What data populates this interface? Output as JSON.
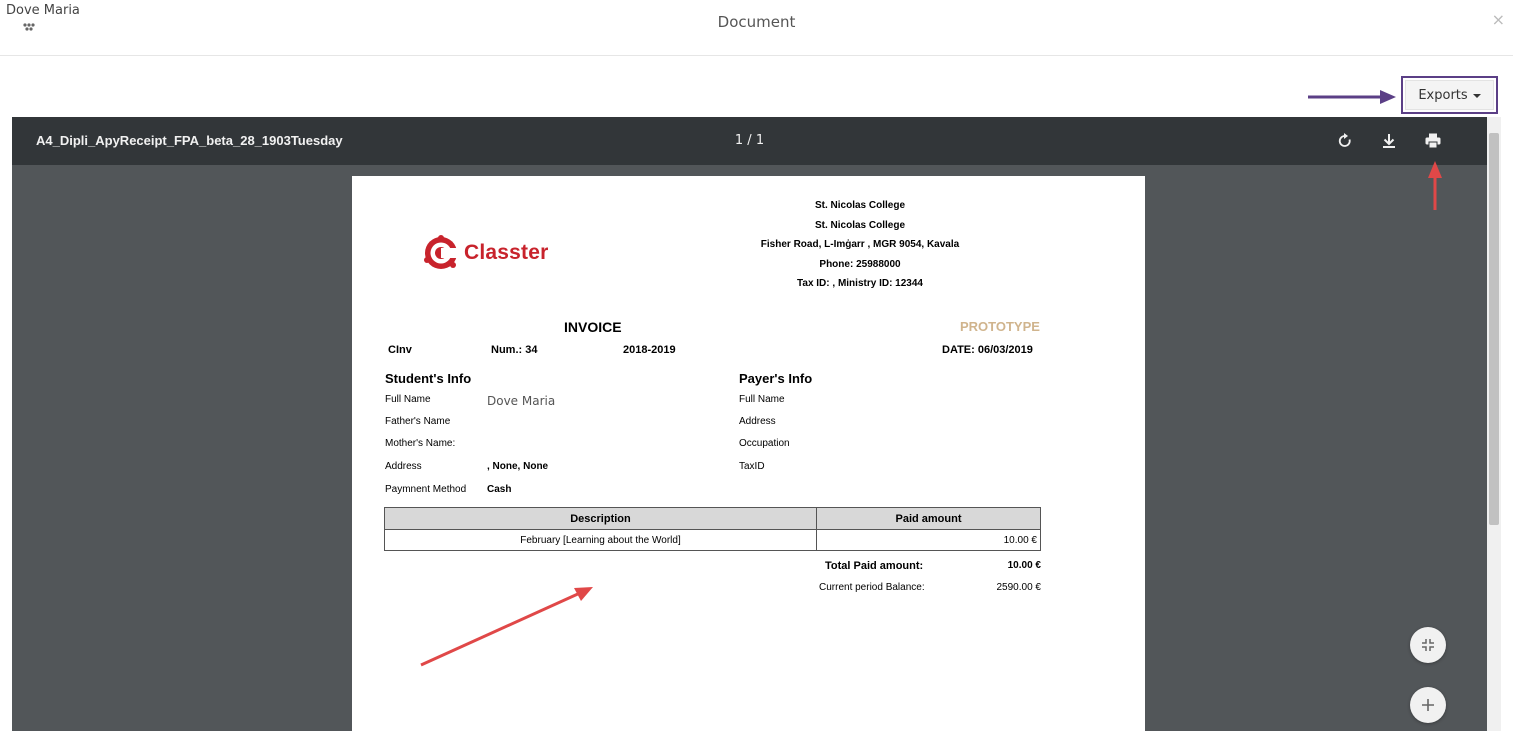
{
  "header": {
    "user_name": "Dove Maria",
    "title": "Document",
    "close_label": "×",
    "menu_icon": "grip-dots-icon"
  },
  "exports": {
    "label": "Exports"
  },
  "viewer": {
    "file_name": "A4_Dipli_ApyReceipt_FPA_beta_28_1903Tuesday",
    "page_counter": "1 / 1",
    "icons": [
      "rotate-icon",
      "download-icon",
      "print-icon"
    ],
    "zoom_icons": [
      "fit-page-icon",
      "zoom-in-icon"
    ]
  },
  "invoice": {
    "logo_text": "Classter",
    "school_lines": [
      "St. Nicolas College",
      "St. Nicolas College",
      "Fisher Road, L-Imġarr , MGR 9054, Kavala",
      "Phone: 25988000",
      "Tax ID: , Ministry ID: 12344"
    ],
    "title": "INVOICE",
    "watermark": "PROTOTYPE",
    "code": "CInv",
    "number": "Num.: 34",
    "year": "2018-2019",
    "date": "DATE: 06/03/2019",
    "student": {
      "heading": "Student's Info",
      "full_name_label": "Full Name",
      "full_name": "Dove Maria",
      "father_label": "Father's Name",
      "mother_label": "Mother's Name:",
      "address_label": "Address",
      "address": ", None, None",
      "payment_label": "Paymnent Method",
      "payment": "Cash"
    },
    "payer": {
      "heading": "Payer's Info",
      "full_name_label": "Full Name",
      "address_label": "Address",
      "occupation_label": "Occupation",
      "taxid_label": "TaxID"
    },
    "table": {
      "headers": [
        "Description",
        "Paid amount"
      ],
      "rows": [
        {
          "description": "February [Learning about the World]",
          "amount": "10.00 €"
        }
      ]
    },
    "total_label": "Total Paid amount:",
    "total_value": "10.00 €",
    "balance_label": "Current period Balance:",
    "balance_value": "2590.00 €"
  },
  "colors": {
    "accent_purple": "#5b3f86",
    "annotation_red": "#e04848",
    "brand_red": "#c8232c",
    "prototype_tan": "#d0b48d",
    "viewer_bg": "#525659",
    "toolbar_bg": "#323639"
  }
}
